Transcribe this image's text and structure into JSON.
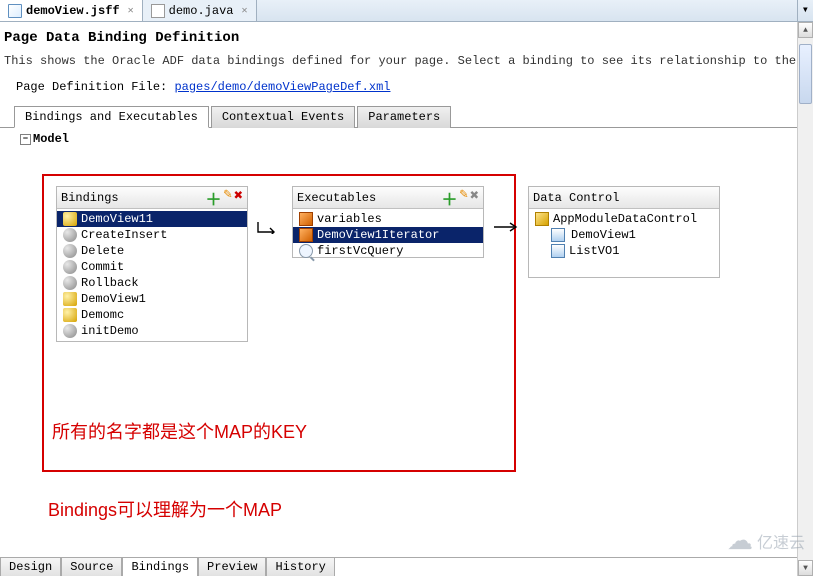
{
  "tabs": {
    "file1": "demoView.jsff",
    "file2": "demo.java"
  },
  "header": {
    "title": "Page Data Binding Definition",
    "desc": "This shows the Oracle ADF data bindings defined for your page. Select a binding to see its relationship to the underlying Data Contro",
    "pagedef_label": "Page Definition File: ",
    "pagedef_link": "pages/demo/demoViewPageDef.xml"
  },
  "main_tabs": {
    "t1": "Bindings and Executables",
    "t2": "Contextual Events",
    "t3": "Parameters"
  },
  "model_label": "Model",
  "panels": {
    "bindings": {
      "title": "Bindings",
      "items": [
        "DemoView11",
        "CreateInsert",
        "Delete",
        "Commit",
        "Rollback",
        "DemoView1",
        "Demomc",
        "initDemo"
      ]
    },
    "execs": {
      "title": "Executables",
      "items": [
        "variables",
        "DemoView1Iterator",
        "firstVcQuery"
      ]
    },
    "datacontrol": {
      "title": "Data Control",
      "root": "AppModuleDataControl",
      "items": [
        "DemoView1",
        "ListVO1"
      ]
    }
  },
  "annotations": {
    "a1": "所有的名字都是这个MAP的KEY",
    "a2": "Bindings可以理解为一个MAP"
  },
  "bottom_tabs": {
    "b1": "Design",
    "b2": "Source",
    "b3": "Bindings",
    "b4": "Preview",
    "b5": "History"
  },
  "watermark": "亿速云"
}
